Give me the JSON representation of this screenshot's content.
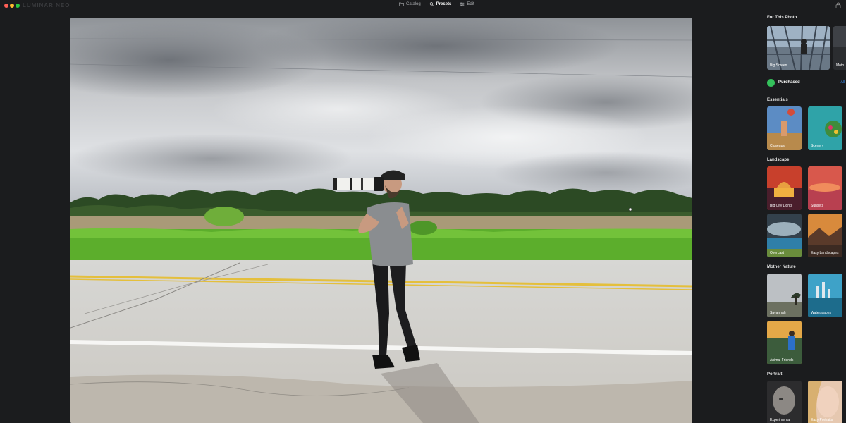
{
  "app": {
    "logo_text": "LUMINAR NEO"
  },
  "nav": {
    "catalog": "Catalog",
    "presets": "Presets",
    "edit": "Edit"
  },
  "sidebar": {
    "for_this_photo": {
      "title": "For This Photo",
      "items": [
        {
          "label": "Big Screen"
        },
        {
          "label": "Moto"
        }
      ]
    },
    "purchased": {
      "label": "Purchased",
      "link": "All"
    },
    "essentials": {
      "title": "Essentials",
      "items": [
        {
          "label": "Closeups"
        },
        {
          "label": "Scenery"
        }
      ]
    },
    "landscape": {
      "title": "Landscape",
      "items": [
        {
          "label": "Big City Lights"
        },
        {
          "label": "Sunsets"
        },
        {
          "label": "Overcast"
        },
        {
          "label": "Easy Landscapes"
        }
      ]
    },
    "mother_nature": {
      "title": "Mother Nature",
      "items": [
        {
          "label": "Savannah"
        },
        {
          "label": "Waterscapes"
        },
        {
          "label": "Animal Friends"
        }
      ]
    },
    "portrait": {
      "title": "Portrait",
      "items": [
        {
          "label": "Experimental"
        },
        {
          "label": "Easy Portraits"
        }
      ]
    }
  },
  "colors": {
    "background": "#1b1c1e",
    "accent_link": "#3a8ef0",
    "purchased_badge": "#34c15b"
  }
}
